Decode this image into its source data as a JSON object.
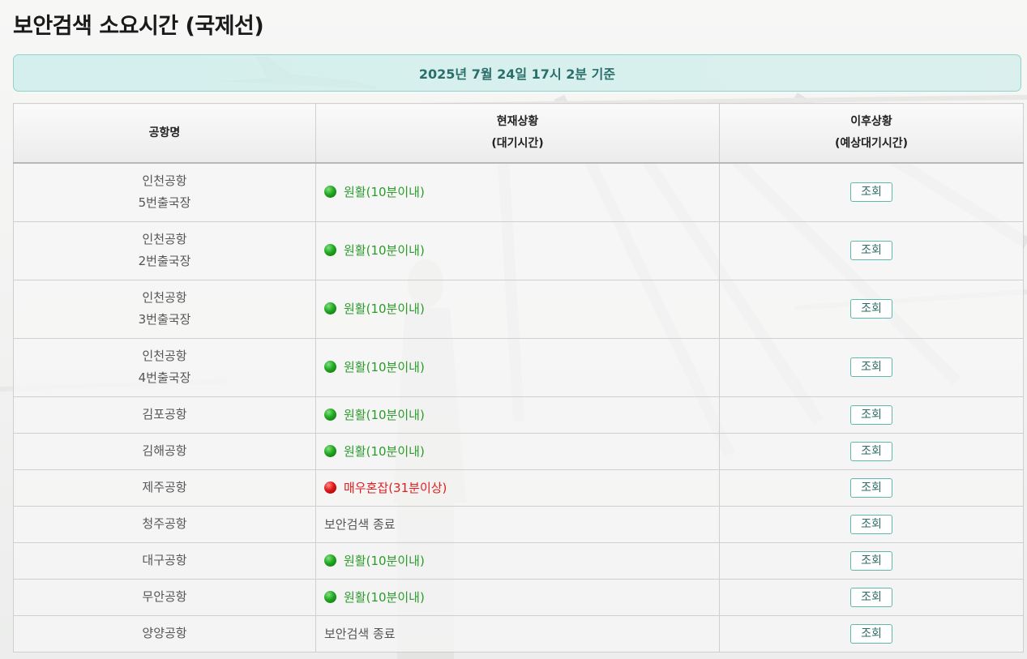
{
  "page": {
    "title": "보안검색 소요시간 (국제선)",
    "timestamp": "2025년 7월 24일 17시 2분 기준"
  },
  "table": {
    "headers": {
      "airport": "공항명",
      "current": "현재상황",
      "current_sub": "(대기시간)",
      "later": "이후상황",
      "later_sub": "(예상대기시간)"
    },
    "rows": [
      {
        "airport": "인천공항",
        "sub": "5번출국장",
        "status": "원활(10분이내)",
        "level": "green",
        "button": "조회"
      },
      {
        "airport": "인천공항",
        "sub": "2번출국장",
        "status": "원활(10분이내)",
        "level": "green",
        "button": "조회"
      },
      {
        "airport": "인천공항",
        "sub": "3번출국장",
        "status": "원활(10분이내)",
        "level": "green",
        "button": "조회"
      },
      {
        "airport": "인천공항",
        "sub": "4번출국장",
        "status": "원활(10분이내)",
        "level": "green",
        "button": "조회"
      },
      {
        "airport": "김포공항",
        "sub": "",
        "status": "원활(10분이내)",
        "level": "green",
        "button": "조회"
      },
      {
        "airport": "김해공항",
        "sub": "",
        "status": "원활(10분이내)",
        "level": "green",
        "button": "조회"
      },
      {
        "airport": "제주공항",
        "sub": "",
        "status": "매우혼잡(31분이상)",
        "level": "red",
        "button": "조회"
      },
      {
        "airport": "청주공항",
        "sub": "",
        "status": "보안검색 종료",
        "level": "none",
        "button": "조회"
      },
      {
        "airport": "대구공항",
        "sub": "",
        "status": "원활(10분이내)",
        "level": "green",
        "button": "조회"
      },
      {
        "airport": "무안공항",
        "sub": "",
        "status": "원활(10분이내)",
        "level": "green",
        "button": "조회"
      },
      {
        "airport": "양양공항",
        "sub": "",
        "status": "보안검색 종료",
        "level": "none",
        "button": "조회"
      }
    ]
  },
  "colors": {
    "smooth": "#2b9b2b",
    "congested": "#e02020",
    "accent": "#5fb8ac",
    "banner_text": "#2a6f6a"
  },
  "icons": {
    "smooth": "green-status-dot-icon",
    "congested": "red-status-dot-icon"
  }
}
